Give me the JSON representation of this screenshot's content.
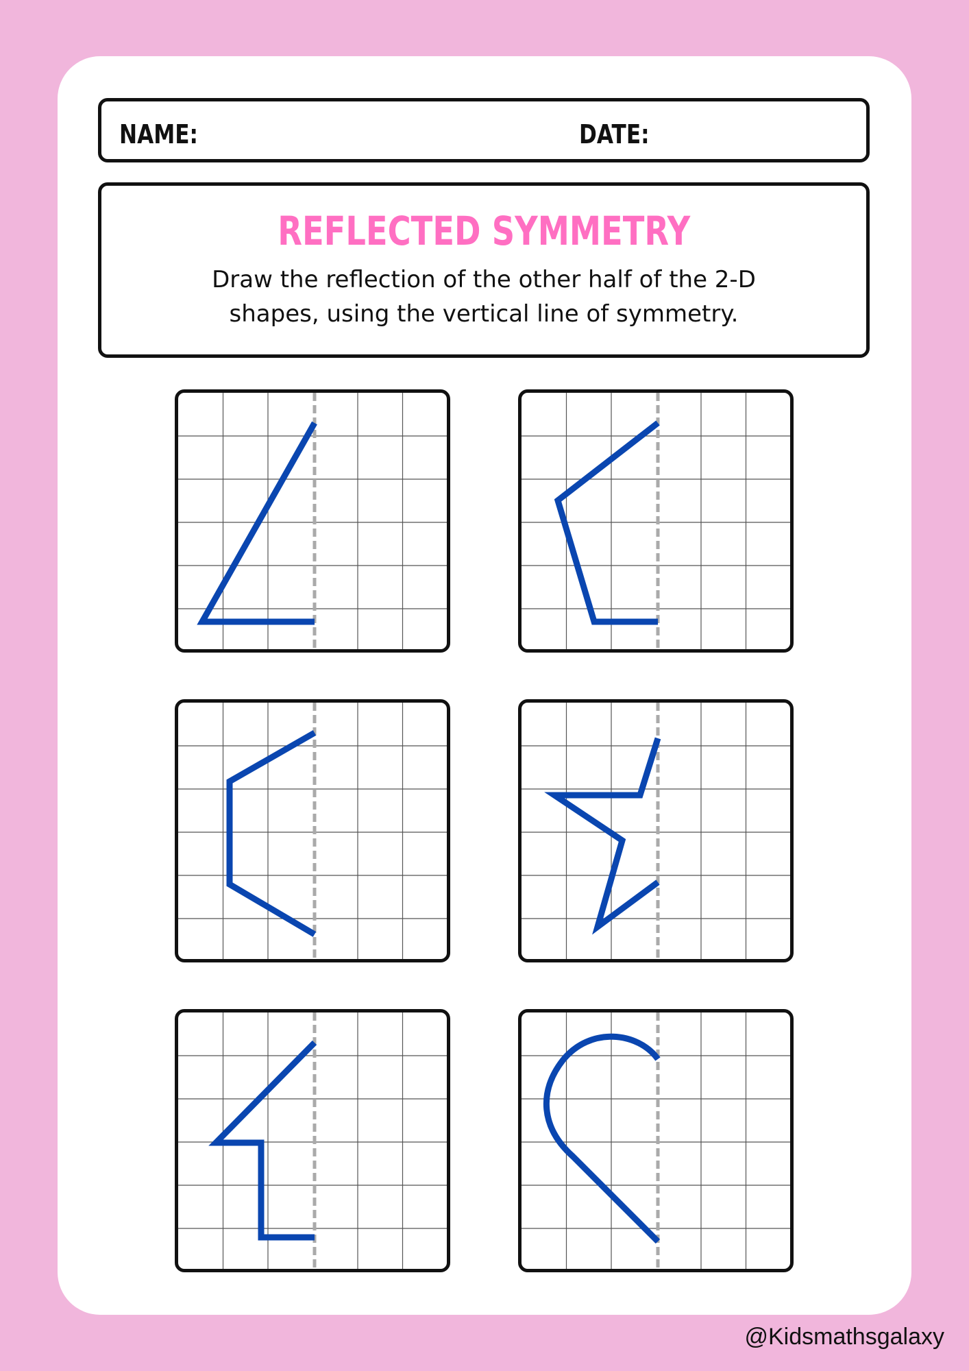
{
  "header": {
    "name_label": "NAME:",
    "date_label": "DATE:"
  },
  "title": "REFLECTED SYMMETRY",
  "instructions_line1": "Draw the reflection of the other half of the 2-D",
  "instructions_line2": "shapes, using the vertical line of symmetry.",
  "credit": "@Kidsmathsgalaxy",
  "colors": {
    "background": "#f1b6dc",
    "title": "#ff6fc2",
    "shape_stroke": "#0a46b0",
    "grid_line": "#555555",
    "symmetry_line": "#aaaaaa"
  },
  "grids": [
    {
      "shape": "triangle"
    },
    {
      "shape": "pentagon-half"
    },
    {
      "shape": "hexagon-half"
    },
    {
      "shape": "star-half"
    },
    {
      "shape": "arrow-half"
    },
    {
      "shape": "heart-half"
    }
  ]
}
